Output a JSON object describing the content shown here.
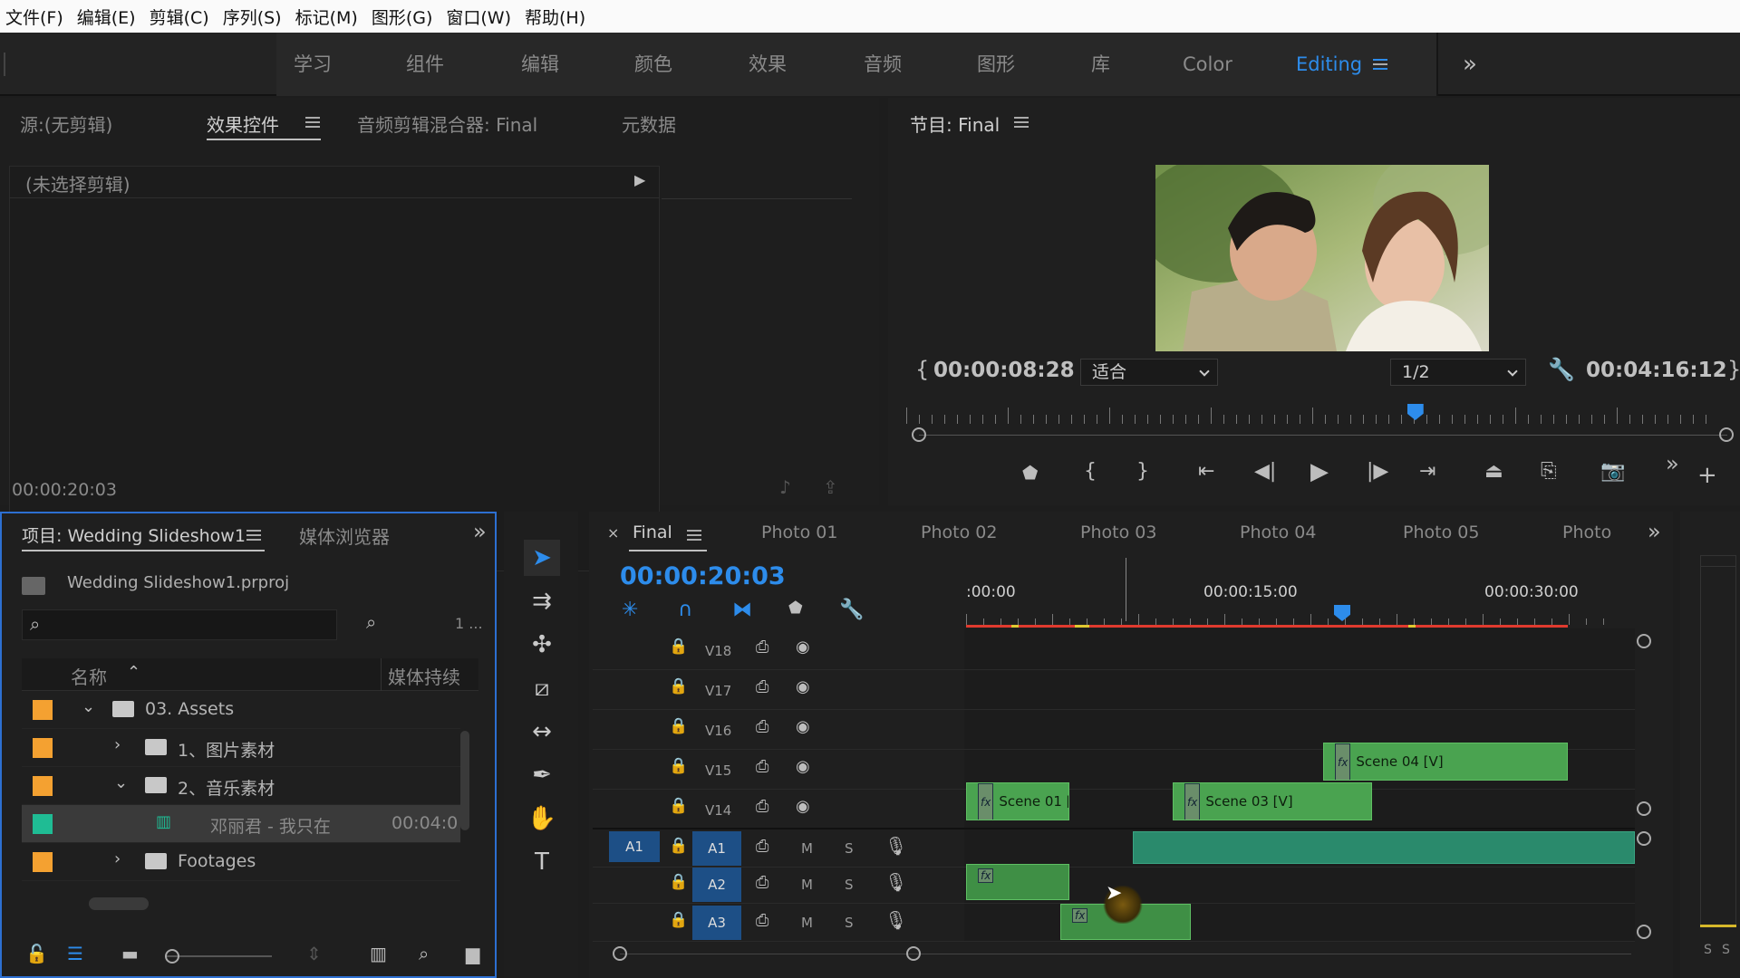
{
  "menu": [
    "文件(F)",
    "编辑(E)",
    "剪辑(C)",
    "序列(S)",
    "标记(M)",
    "图形(G)",
    "窗口(W)",
    "帮助(H)"
  ],
  "workspaces": [
    "学习",
    "组件",
    "编辑",
    "颜色",
    "效果",
    "音频",
    "图形",
    "库",
    "Color",
    "Editing"
  ],
  "workspace_active": "Editing",
  "source_panel": {
    "tabs": [
      "源:(无剪辑)",
      "效果控件",
      "音频剪辑混合器: Final",
      "元数据"
    ],
    "active_tab": "效果控件",
    "no_clip": "(未选择剪辑)",
    "timecode": "00:00:20:03"
  },
  "program_panel": {
    "title": "节目: Final",
    "timecode_left": "00:00:08:28",
    "fit": "适合",
    "resolution": "1/2",
    "timecode_right": "00:04:16:12",
    "playhead_fraction": 0.62
  },
  "project_panel": {
    "tabs": [
      "项目: Wedding Slideshow1",
      "媒体浏览器"
    ],
    "file": "Wedding Slideshow1.prproj",
    "search_placeholder": "",
    "count": "1 ...",
    "columns": [
      "名称",
      "媒体持续"
    ],
    "items": [
      {
        "name": "03. Assets",
        "color": "#f4a131",
        "indent": 0,
        "expanded": true,
        "type": "folder"
      },
      {
        "name": "1、图片素材",
        "color": "#f4a131",
        "indent": 1,
        "expanded": false,
        "type": "folder"
      },
      {
        "name": "2、音乐素材",
        "color": "#f4a131",
        "indent": 1,
        "expanded": true,
        "type": "folder"
      },
      {
        "name": "邓丽君 - 我只在",
        "color": "#1fbc94",
        "indent": 2,
        "type": "audio",
        "duration": "00:04:0"
      },
      {
        "name": "Footages",
        "color": "#f4a131",
        "indent": 1,
        "expanded": false,
        "type": "folder"
      }
    ]
  },
  "timeline": {
    "tabs": [
      "Final",
      "Photo 01",
      "Photo 02",
      "Photo 03",
      "Photo 04",
      "Photo 05",
      "Photo"
    ],
    "timecode": "00:00:20:03",
    "ruler": [
      ":00:00",
      "00:00:15:00",
      "00:00:30:00"
    ],
    "video_tracks": [
      "V18",
      "V17",
      "V16",
      "V15",
      "V14"
    ],
    "audio_tracks": [
      "A1",
      "A2",
      "A3"
    ],
    "source_patch": "A1",
    "clips": [
      {
        "label": "Scene 04 [V]",
        "track": "V15"
      },
      {
        "label": "Scene 01 [",
        "track": "V14"
      },
      {
        "label": "Scene 03 [V]",
        "track": "V14"
      }
    ],
    "m": "M",
    "s": "S"
  },
  "meter": {
    "labels": [
      "S",
      "S"
    ]
  },
  "colors": {
    "accent": "#2d8ceb",
    "clip_green": "#4aa350",
    "audio_clip": "#2a8a6c",
    "red_bar": "#e03a2e"
  }
}
